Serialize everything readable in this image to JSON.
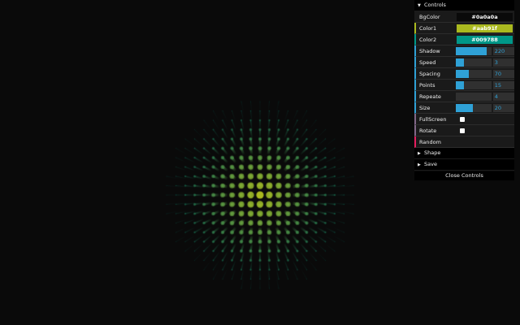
{
  "scene": {
    "background": "#0a0a0a",
    "color1": "#aab91f",
    "color2": "#009788"
  },
  "gui": {
    "controls_title": "Controls",
    "rows": {
      "bgcolor": {
        "label": "BgColor",
        "value": "#0a0a0a",
        "bg": "#0a0a0a",
        "fg": "#ffffff"
      },
      "color1": {
        "label": "Color1",
        "value": "#aab91f",
        "bg": "#aab91f",
        "fg": "#ffffff"
      },
      "color2": {
        "label": "Color2",
        "value": "#009788",
        "bg": "#009788",
        "fg": "#ffffff"
      },
      "shadow": {
        "label": "Shadow",
        "value": "220",
        "fraction": 0.88
      },
      "speed": {
        "label": "Speed",
        "value": "3",
        "fraction": 0.22
      },
      "spacing": {
        "label": "Spacing",
        "value": "70",
        "fraction": 0.36
      },
      "points": {
        "label": "Points",
        "value": "15",
        "fraction": 0.22
      },
      "repeate": {
        "label": "Repeate",
        "value": "4",
        "fraction": 0.0
      },
      "size": {
        "label": "Size",
        "value": "20",
        "fraction": 0.48
      },
      "fullscreen": {
        "label": "FullScreen",
        "checked": false
      },
      "rotate": {
        "label": "Rotate",
        "checked": false
      },
      "random": {
        "label": "Random"
      }
    },
    "shape_title": "Shape",
    "save_title": "Save",
    "close_label": "Close Controls"
  }
}
